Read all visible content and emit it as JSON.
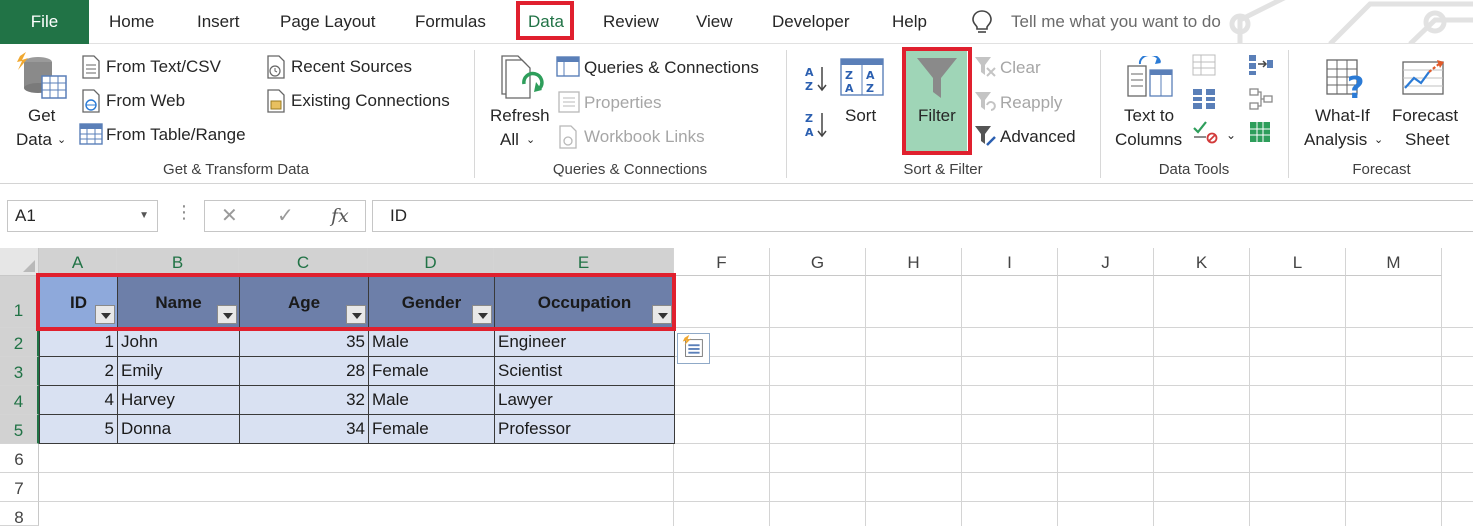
{
  "tabs": {
    "file": "File",
    "home": "Home",
    "insert": "Insert",
    "page_layout": "Page Layout",
    "formulas": "Formulas",
    "data": "Data",
    "review": "Review",
    "view": "View",
    "developer": "Developer",
    "help": "Help",
    "tell_me": "Tell me what you want to do"
  },
  "ribbon": {
    "get_transform": {
      "get_data_line1": "Get",
      "get_data_line2": "Data",
      "from_text_csv": "From Text/CSV",
      "from_web": "From Web",
      "from_table_range": "From Table/Range",
      "recent_sources": "Recent Sources",
      "existing_connections": "Existing Connections",
      "label": "Get & Transform Data"
    },
    "queries": {
      "refresh_line1": "Refresh",
      "refresh_line2": "All",
      "queries_connections": "Queries & Connections",
      "properties": "Properties",
      "workbook_links": "Workbook Links",
      "label": "Queries & Connections"
    },
    "sort_filter": {
      "sort": "Sort",
      "filter": "Filter",
      "clear": "Clear",
      "reapply": "Reapply",
      "advanced": "Advanced",
      "label": "Sort & Filter"
    },
    "data_tools": {
      "text_to_line1": "Text to",
      "text_to_line2": "Columns",
      "label": "Data Tools"
    },
    "forecast": {
      "whatif_line1": "What-If",
      "whatif_line2": "Analysis",
      "forecast_line1": "Forecast",
      "forecast_line2": "Sheet",
      "label": "Forecast"
    }
  },
  "formula_bar": {
    "name_box": "A1",
    "cancel": "✕",
    "enter": "✓",
    "fx": "fx",
    "content": "ID"
  },
  "grid": {
    "columns": [
      "A",
      "B",
      "C",
      "D",
      "E",
      "F",
      "G",
      "H",
      "I",
      "J",
      "K",
      "L",
      "M"
    ],
    "rows": [
      "1",
      "2",
      "3",
      "4",
      "5",
      "6",
      "7",
      "8"
    ],
    "headers": [
      "ID",
      "Name",
      "Age",
      "Gender",
      "Occupation"
    ],
    "data": [
      [
        "1",
        "John",
        "35",
        "Male",
        "Engineer"
      ],
      [
        "2",
        "Emily",
        "28",
        "Female",
        "Scientist"
      ],
      [
        "4",
        "Harvey",
        "32",
        "Male",
        "Lawyer"
      ],
      [
        "5",
        "Donna",
        "34",
        "Female",
        "Professor"
      ]
    ]
  },
  "colors": {
    "accent": "#217346",
    "highlight_box": "#e0202e",
    "header_fill": "#6d7fa9",
    "header_fill_first": "#8ea9db",
    "data_fill": "#d9e1f2",
    "filter_active": "#9fd5b7"
  },
  "icons": {
    "tell_me": "lightbulb-icon",
    "filter": "funnel-icon",
    "filter_dropdown": "dropdown-arrow-icon"
  }
}
